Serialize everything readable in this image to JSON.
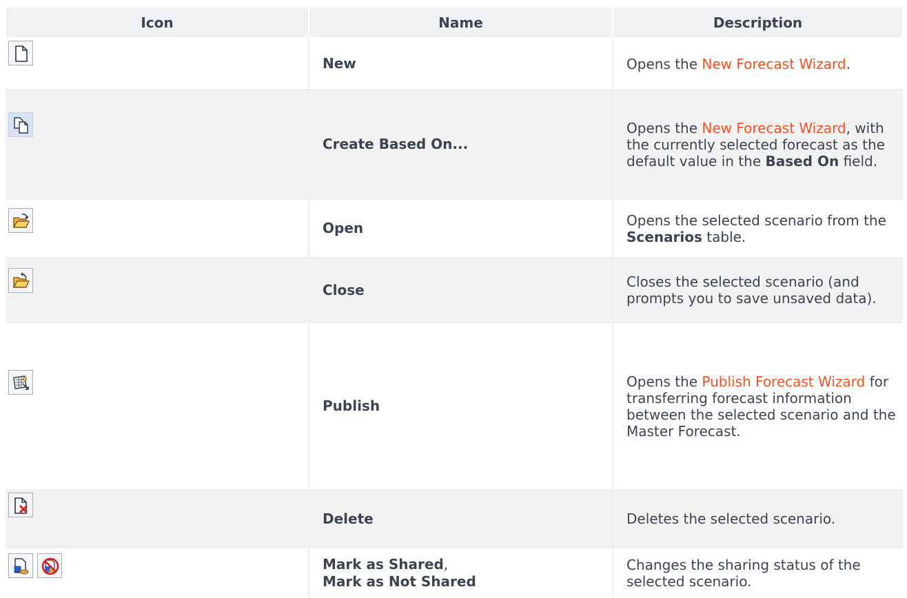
{
  "headers": {
    "icon": "Icon",
    "name": "Name",
    "description": "Description"
  },
  "rows": [
    {
      "name": "New",
      "desc_pre": "Opens the ",
      "desc_link": "New Forecast Wizard",
      "desc_post": "."
    },
    {
      "name": "Create Based On...",
      "desc_pre": "Opens the ",
      "desc_link": "New Forecast Wizard",
      "desc_mid": ", with the currently selected forecast as the default value in the ",
      "desc_bold": "Based On",
      "desc_post": " field."
    },
    {
      "name": "Open",
      "desc_pre": "Opens the selected scenario from the ",
      "desc_bold": "Scenarios",
      "desc_post": " table."
    },
    {
      "name": "Close",
      "desc": "Closes the selected scenario (and prompts you to save unsaved data)."
    },
    {
      "name": "Publish",
      "desc_pre": "Opens the ",
      "desc_link": "Publish Forecast Wizard",
      "desc_post": " for transferring forecast information between the selected scenario and the Master Forecast."
    },
    {
      "name": "Delete",
      "desc": "Deletes the selected scenario."
    },
    {
      "name_a": "Mark as Shared",
      "name_sep": ",",
      "name_b": "Mark as Not Shared",
      "desc": "Changes the sharing status of the selected scenario."
    }
  ],
  "icons": {
    "new": "new-document-icon",
    "create_based_on": "copy-document-icon",
    "open": "open-folder-icon",
    "close": "close-folder-icon",
    "publish": "publish-icon",
    "delete": "delete-document-icon",
    "mark_shared": "mark-shared-icon",
    "mark_not_shared": "mark-not-shared-icon"
  },
  "colors": {
    "link": "#ff4f1f",
    "text": "#3d4451",
    "header_bg": "#f0f1f2",
    "row_alt_bg": "#f2f2f3"
  }
}
